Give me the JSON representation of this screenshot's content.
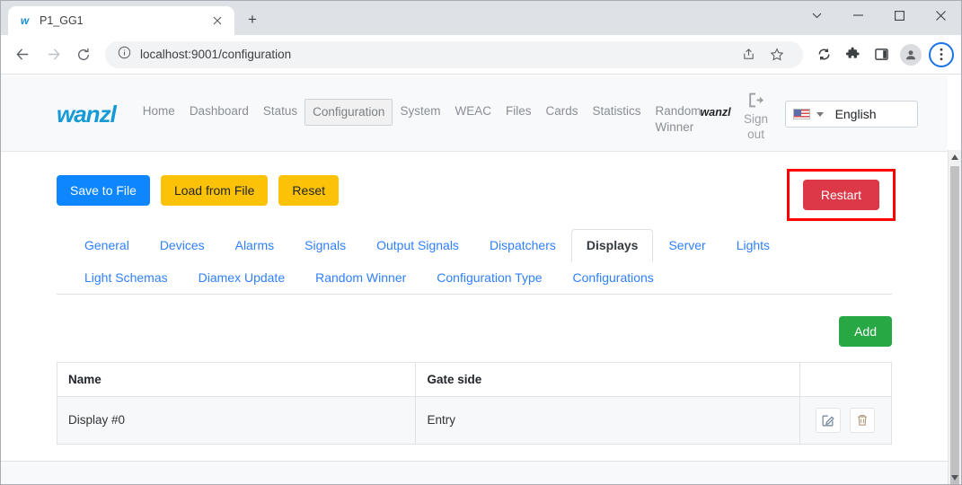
{
  "browser": {
    "tab": {
      "title": "P1_GG1",
      "favicon": "w",
      "close_icon": "close-icon"
    },
    "new_tab_label": "+",
    "window_controls": [
      "tab-search-chevron",
      "minimize",
      "maximize",
      "close"
    ],
    "url": "localhost:9001/configuration",
    "nav": {
      "back": "back-arrow",
      "forward": "forward-arrow",
      "reload": "reload-icon"
    },
    "omnibox_icons": [
      "info-circle-icon",
      "share-icon",
      "bookmark-star-icon"
    ],
    "toolbar_icons": [
      "sync-icon",
      "extensions-puzzle-icon",
      "side-panel-icon",
      "profile-avatar",
      "three-dot-menu-icon"
    ]
  },
  "appnav": {
    "brand": "wanzl",
    "links": [
      {
        "label": "Home",
        "active": false
      },
      {
        "label": "Dashboard",
        "active": false
      },
      {
        "label": "Status",
        "active": false
      },
      {
        "label": "Configuration",
        "active": true
      },
      {
        "label": "System",
        "active": false
      },
      {
        "label": "WEAC",
        "active": false
      },
      {
        "label": "Files",
        "active": false
      },
      {
        "label": "Cards",
        "active": false
      },
      {
        "label": "Statistics",
        "active": false
      },
      {
        "label": "Random Winner",
        "active": false
      }
    ],
    "user": "wanzl",
    "signout_label": "Sign out",
    "signout_icon": "sign-out-icon",
    "language": {
      "label": "English",
      "flag": "us-flag-icon"
    }
  },
  "toolbar": {
    "save_label": "Save to File",
    "load_label": "Load from File",
    "reset_label": "Reset",
    "restart_label": "Restart"
  },
  "tabs": [
    {
      "label": "General",
      "active": false
    },
    {
      "label": "Devices",
      "active": false
    },
    {
      "label": "Alarms",
      "active": false
    },
    {
      "label": "Signals",
      "active": false
    },
    {
      "label": "Output Signals",
      "active": false
    },
    {
      "label": "Dispatchers",
      "active": false
    },
    {
      "label": "Displays",
      "active": true
    },
    {
      "label": "Server",
      "active": false
    },
    {
      "label": "Lights",
      "active": false
    },
    {
      "label": "Light Schemas",
      "active": false
    },
    {
      "label": "Diamex Update",
      "active": false
    },
    {
      "label": "Random Winner",
      "active": false
    },
    {
      "label": "Configuration Type",
      "active": false
    },
    {
      "label": "Configurations",
      "active": false
    }
  ],
  "main": {
    "add_label": "Add",
    "table": {
      "headers": [
        "Name",
        "Gate side",
        ""
      ],
      "rows": [
        {
          "name": "Display #0",
          "gate_side": "Entry",
          "edit_icon": "edit-pencil-icon",
          "delete_icon": "trash-icon"
        }
      ]
    }
  },
  "footer": {
    "text": ""
  },
  "colors": {
    "brand": "#159ad6",
    "primary": "#0d86ff",
    "warning": "#fcc208",
    "danger": "#dc3848",
    "success": "#28a745",
    "highlight_box": "#ff0000",
    "tab_link": "#2f7fff"
  }
}
